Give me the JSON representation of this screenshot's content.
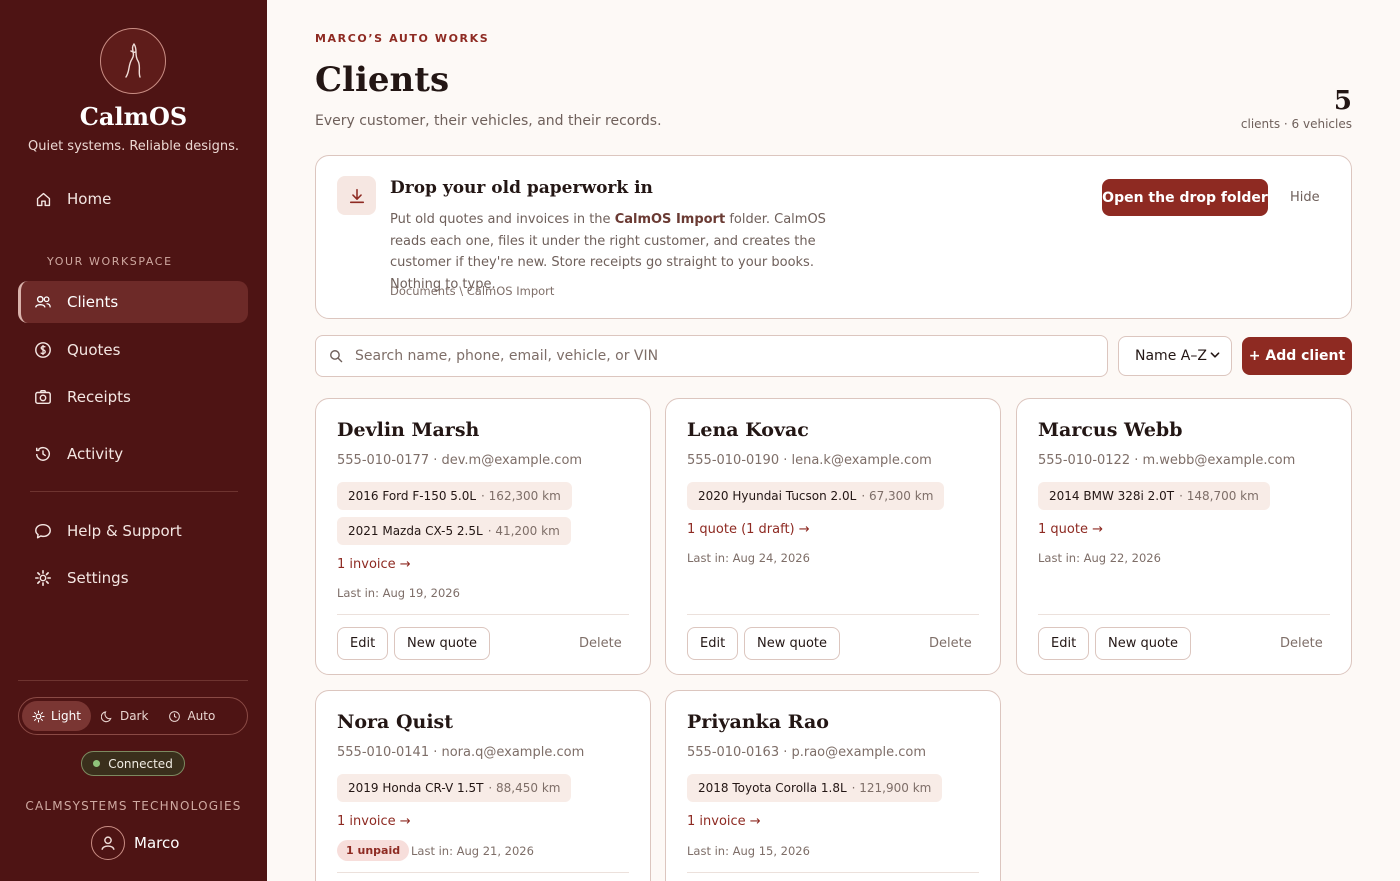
{
  "sidebar": {
    "brand_name": "CalmOS",
    "brand_tagline": "Quiet systems. Reliable designs.",
    "home_label": "Home",
    "section_label": "YOUR WORKSPACE",
    "items": [
      {
        "label": "Clients",
        "icon": "users-icon",
        "active": true
      },
      {
        "label": "Quotes",
        "icon": "dollar-icon"
      },
      {
        "label": "Receipts",
        "icon": "camera-icon"
      },
      {
        "label": "Activity",
        "icon": "history-icon"
      }
    ],
    "help_label": "Help & Support",
    "settings_label": "Settings",
    "theme_options": [
      "Light",
      "Dark",
      "Auto"
    ],
    "theme_selected": "Light",
    "status": "Connected",
    "company": "CALMSYSTEMS TECHNOLOGIES",
    "user_name": "Marco"
  },
  "header": {
    "eyebrow": "MARCO’S AUTO WORKS",
    "title": "Clients",
    "subtitle": "Every customer, their vehicles, and their records.",
    "count": "5",
    "count_sub": "clients · 6 vehicles"
  },
  "drop_banner": {
    "title": "Drop your old paperwork in",
    "text_before": "Put old quotes and invoices in the ",
    "text_bold": "CalmOS Import",
    "text_after": " folder. CalmOS reads each one, files it under the right customer, and creates the customer if they're new. Store receipts go straight to your books. Nothing to type.",
    "path": "Documents \\ CalmOS Import",
    "open_label": "Open the drop folder",
    "hide_label": "Hide"
  },
  "toolbar": {
    "search_placeholder": "Search name, phone, email, vehicle, or VIN",
    "sort_value": "Name A–Z",
    "add_label": "+ Add client"
  },
  "card_actions": {
    "edit": "Edit",
    "new_quote": "New quote",
    "delete": "Delete"
  },
  "clients": [
    {
      "name": "Devlin Marsh",
      "contact": "555-010-0177 · dev.m@example.com",
      "vehicles": [
        {
          "name": "2016 Ford F-150 5.0L",
          "km": "· 162,300 km"
        },
        {
          "name": "2021 Mazda CX-5 2.5L",
          "km": "· 41,200 km"
        }
      ],
      "link": "1 invoice →",
      "last": "Last in: Aug 19, 2026"
    },
    {
      "name": "Lena Kovac",
      "contact": "555-010-0190 · lena.k@example.com",
      "vehicles": [
        {
          "name": "2020 Hyundai Tucson 2.0L",
          "km": "· 67,300 km"
        }
      ],
      "link": "1 quote (1 draft) →",
      "last": "Last in: Aug 24, 2026"
    },
    {
      "name": "Marcus Webb",
      "contact": "555-010-0122 · m.webb@example.com",
      "vehicles": [
        {
          "name": "2014 BMW 328i 2.0T",
          "km": "· 148,700 km"
        }
      ],
      "link": "1 quote →",
      "last": "Last in: Aug 22, 2026"
    },
    {
      "name": "Nora Quist",
      "contact": "555-010-0141 · nora.q@example.com",
      "vehicles": [
        {
          "name": "2019 Honda CR-V 1.5T",
          "km": "· 88,450 km"
        }
      ],
      "link": "1 invoice →",
      "badge": "1 unpaid",
      "last": "Last in: Aug 21, 2026"
    },
    {
      "name": "Priyanka Rao",
      "contact": "555-010-0163 · p.rao@example.com",
      "vehicles": [
        {
          "name": "2018 Toyota Corolla 1.8L",
          "km": "· 121,900 km"
        }
      ],
      "link": "1 invoice →",
      "last": "Last in: Aug 15, 2026"
    }
  ],
  "colors": {
    "sidebar": "#4e1414",
    "accent": "#8e2a22",
    "background": "#fdf9f6"
  }
}
